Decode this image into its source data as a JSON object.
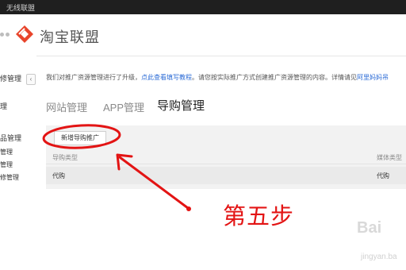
{
  "window": {
    "title": "无线联盟"
  },
  "brand": {
    "logo_text": "淘宝联盟",
    "logo_color": "#e8442b"
  },
  "sidebar": {
    "items": [
      {
        "label": "修管理"
      },
      {
        "label": "理"
      },
      {
        "label": "品管理"
      },
      {
        "label": "管理"
      },
      {
        "label": "管理"
      },
      {
        "label": "修管理"
      }
    ],
    "collapse_glyph": "‹"
  },
  "notice": {
    "text": "我们对推广资源管理进行了升级，",
    "link1": "点此查看填写教程",
    "text2": "。请您按实际推广方式创建推广资源管理的内容。详情请见",
    "link2": "阿里妈妈吊"
  },
  "tabs": [
    {
      "label": "网站管理",
      "active": false
    },
    {
      "label": "APP管理",
      "active": false
    },
    {
      "label": "导购管理",
      "active": true
    }
  ],
  "panel": {
    "new_button": "新增导购推广",
    "columns": [
      "导购类型",
      "媒体类型"
    ],
    "rows": [
      {
        "cells": [
          "代购",
          "代购"
        ]
      }
    ]
  },
  "annotation": {
    "step_text": "第五步",
    "color": "#e31414"
  },
  "watermark": {
    "line1": "Bai",
    "line2": "jingyan.ba"
  }
}
